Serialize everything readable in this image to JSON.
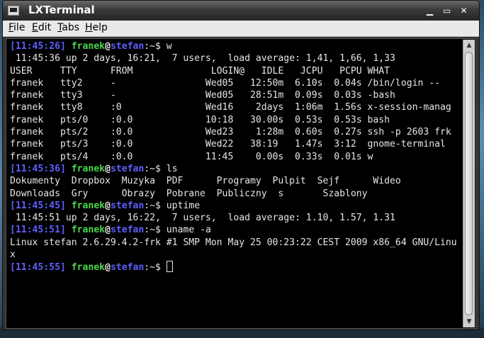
{
  "window": {
    "title": "LXTerminal",
    "buttons": {
      "minimize": "▁",
      "maximize": "▭",
      "close": "✕"
    }
  },
  "menubar": {
    "items": [
      {
        "first": "F",
        "rest": "ile"
      },
      {
        "first": "E",
        "rest": "dit"
      },
      {
        "first": "T",
        "rest": "abs"
      },
      {
        "first": "H",
        "rest": "elp"
      }
    ]
  },
  "terminal": {
    "prompt": {
      "user": "franek",
      "at": "@",
      "host": "stefan",
      "path": ":~$ "
    },
    "lines": [
      {
        "kind": "prompt",
        "time": "[11:45:26]",
        "cmd": "w"
      },
      {
        "kind": "out",
        "text": " 11:45:36 up 2 days, 16:21,  7 users,  load average: 1,41, 1,66, 1,33"
      },
      {
        "kind": "out",
        "text": "USER     TTY      FROM              LOGIN@   IDLE   JCPU   PCPU WHAT"
      },
      {
        "kind": "out",
        "text": "franek   tty2     -                Wed05   12:50m  6.10s  0.04s /bin/login --"
      },
      {
        "kind": "out",
        "text": "franek   tty3     -                Wed05   28:51m  0.09s  0.03s -bash"
      },
      {
        "kind": "out",
        "text": "franek   tty8     :0               Wed16    2days  1:06m  1.56s x-session-manag"
      },
      {
        "kind": "out",
        "text": "franek   pts/0    :0.0             10:18   30.00s  0.53s  0.53s bash"
      },
      {
        "kind": "out",
        "text": "franek   pts/2    :0.0             Wed23    1:28m  0.60s  0.27s ssh -p 2603 frk"
      },
      {
        "kind": "out",
        "text": "franek   pts/3    :0.0             Wed22   38:19   1.47s  3:12  gnome-terminal"
      },
      {
        "kind": "out",
        "text": "franek   pts/4    :0.0             11:45    0.00s  0.33s  0.01s w"
      },
      {
        "kind": "prompt",
        "time": "[11:45:36]",
        "cmd": "ls"
      },
      {
        "kind": "out",
        "text": "Dokumenty  Dropbox  Muzyka  PDF      Programy  Pulpit  Sejf      Wideo"
      },
      {
        "kind": "out",
        "text": "Downloads  Gry      Obrazy  Pobrane  Publiczny  s       Szablony"
      },
      {
        "kind": "prompt",
        "time": "[11:45:45]",
        "cmd": "uptime"
      },
      {
        "kind": "out",
        "text": " 11:45:51 up 2 days, 16:22,  7 users,  load average: 1.10, 1.57, 1.31"
      },
      {
        "kind": "prompt",
        "time": "[11:45:51]",
        "cmd": "uname -a"
      },
      {
        "kind": "out",
        "text": "Linux stefan 2.6.29.4.2-frk #1 SMP Mon May 25 00:23:22 CEST 2009 x86_64 GNU/Linu"
      },
      {
        "kind": "out",
        "text": "x"
      },
      {
        "kind": "prompt",
        "time": "[11:45:55]",
        "cmd": "",
        "cursor": true
      }
    ]
  },
  "scrollbar": {
    "up": "▲",
    "down": "▼"
  }
}
